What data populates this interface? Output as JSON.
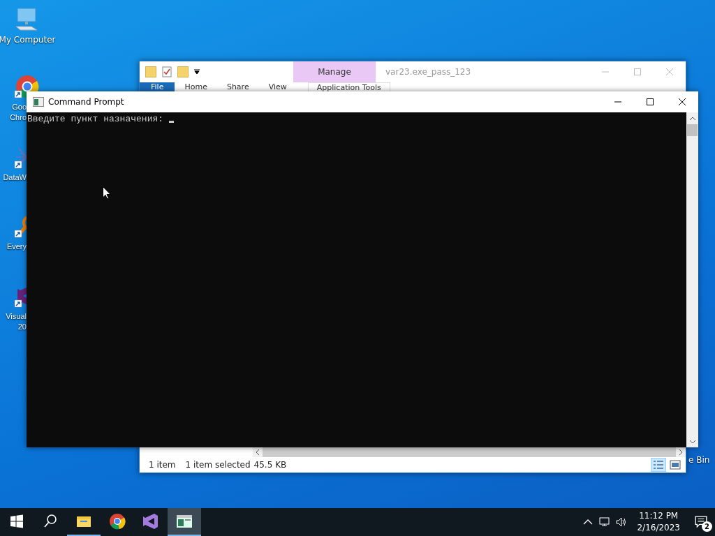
{
  "desktop_icons": [
    {
      "kind": "computer",
      "label_lines": [
        "My Computer"
      ]
    },
    {
      "kind": "chrome",
      "label_lines": [
        "Goo",
        "Chro"
      ]
    },
    {
      "kind": "dataw",
      "label_lines": [
        "DataW"
      ]
    },
    {
      "kind": "everything",
      "label_lines": [
        "Every"
      ]
    },
    {
      "kind": "vs",
      "label_lines": [
        "Visual",
        "20"
      ]
    }
  ],
  "recycle_bin": {
    "label": "e Bin"
  },
  "explorer": {
    "title": "var23.exe_pass_123",
    "context_tab": "Manage",
    "context_group": "Application Tools",
    "ribbon_tabs": [
      {
        "label": "File",
        "kind": "file"
      },
      {
        "label": "Home",
        "kind": "tab"
      },
      {
        "label": "Share",
        "kind": "tab"
      },
      {
        "label": "View",
        "kind": "tab"
      }
    ],
    "status": [
      "1 item",
      "1 item selected",
      "45.5 KB"
    ],
    "views": [
      {
        "kind": "details",
        "selected": true
      },
      {
        "kind": "large",
        "selected": false
      }
    ]
  },
  "cmd": {
    "title": "Command Prompt",
    "lines": [
      "Введите пункт назначения:"
    ]
  },
  "taskbar": {
    "apps": [
      {
        "kind": "explorer",
        "running": true,
        "selected": false
      },
      {
        "kind": "chrome",
        "running": false,
        "selected": false
      },
      {
        "kind": "vs",
        "running": false,
        "selected": false
      },
      {
        "kind": "cmd",
        "running": true,
        "selected": true
      }
    ],
    "time": "11:12 PM",
    "date": "2/16/2023",
    "notifications": "2"
  }
}
